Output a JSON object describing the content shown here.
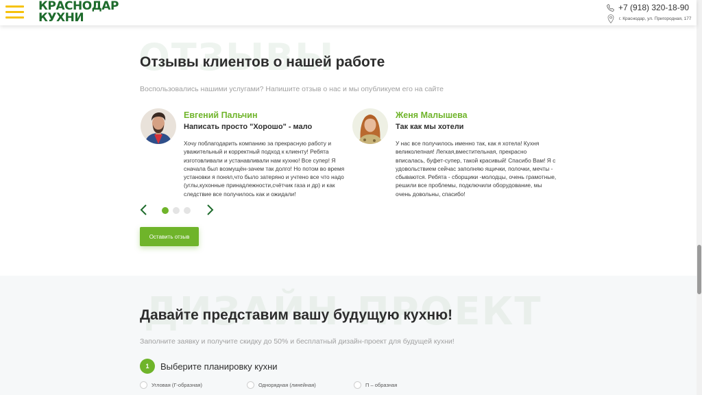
{
  "header": {
    "logo_line1": "КРАСНОДАР",
    "logo_line2": "КУХНИ",
    "phone": "+7 (918) 320-18-90",
    "address": "г. Краснодар, ул. Пригородная, 177"
  },
  "reviews": {
    "watermark": "ОТЗЫВЫ",
    "title": "Отзывы клиентов о нашей работе",
    "subtitle": "Воспользовались нашими услугами? Напишите отзыв о нас и мы опубликуем его на сайте",
    "items": [
      {
        "name": "Евгений Пальчин",
        "title": "Написать просто \"Хорошо\" - мало",
        "text": "Хочу поблагодарить компанию за прекрасную работу и уважительный и корректный подход к клиенту! Ребята изготовливали и устанавливали нам кухню! Все супер! Я сначала был возмущён-зачем так долго! Но потом во время установки я понял,что было затеряно и учтено все что надо (углы,кухонные принадлежности,счётчик газа и др) и как следствие все получилось как и ожидали!"
      },
      {
        "name": "Женя Малышева",
        "title": "Так как мы хотели",
        "text": "У нас все получилось именно так, как я хотела! Кухня великолепная! Легкая,вместительная, прекрасно вписалась, буфет-супер, такой красивый! Спасибо Вам! Я с удовольствием сейчас заполняю ящички, полочки, мечты - сбываются. Ребята - сборщики -молодцы, очень грамотные, решили все проблемы, подключили оборудование, мы очень довольны, спасибо!"
      }
    ],
    "pagination": {
      "count": 3,
      "active": 1
    },
    "leave_review_label": "Оставить отзыв"
  },
  "design": {
    "watermark": "ДИЗАЙН-ПРОЕКТ",
    "title": "Давайте представим вашу будущую кухню!",
    "subtitle": "Заполните заявку и получите скидку до 50% и бесплатный дизайн-проект для будущей кухни!",
    "step_number": "1",
    "step_label": "Выберите планировку кухни",
    "options": [
      "Угловая (Г-образная)",
      "Однорядная (линейная)",
      "П – образная"
    ]
  },
  "colors": {
    "accent": "#6fb42a",
    "logo": "#1e6b2c",
    "burger": "#f6c20a"
  },
  "icons": {
    "menu": "hamburger-icon",
    "phone": "phone-icon",
    "location": "location-pin-icon",
    "prev": "chevron-left-icon",
    "next": "chevron-right-icon"
  }
}
